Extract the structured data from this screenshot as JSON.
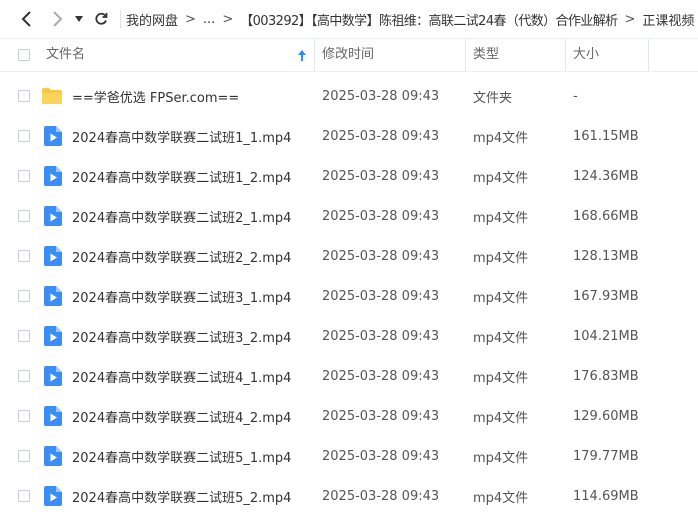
{
  "breadcrumb": {
    "items": [
      "我的网盘",
      "...",
      "【003292】【高中数学】陈祖维：高联二试24春（代数）合作业解析",
      "正课视频"
    ]
  },
  "table": {
    "columns": {
      "name": "文件名",
      "modified": "修改时间",
      "type": "类型",
      "size": "大小"
    },
    "rows": [
      {
        "name": "==学爸优选 FPSer.com==",
        "modified": "2025-03-28 09:43",
        "type": "文件夹",
        "size": "-",
        "icon": "folder-icon"
      },
      {
        "name": "2024春高中数学联赛二试班1_1.mp4",
        "modified": "2025-03-28 09:43",
        "type": "mp4文件",
        "size": "161.15MB",
        "icon": "video-file-icon"
      },
      {
        "name": "2024春高中数学联赛二试班1_2.mp4",
        "modified": "2025-03-28 09:43",
        "type": "mp4文件",
        "size": "124.36MB",
        "icon": "video-file-icon"
      },
      {
        "name": "2024春高中数学联赛二试班2_1.mp4",
        "modified": "2025-03-28 09:43",
        "type": "mp4文件",
        "size": "168.66MB",
        "icon": "video-file-icon"
      },
      {
        "name": "2024春高中数学联赛二试班2_2.mp4",
        "modified": "2025-03-28 09:43",
        "type": "mp4文件",
        "size": "128.13MB",
        "icon": "video-file-icon"
      },
      {
        "name": "2024春高中数学联赛二试班3_1.mp4",
        "modified": "2025-03-28 09:43",
        "type": "mp4文件",
        "size": "167.93MB",
        "icon": "video-file-icon"
      },
      {
        "name": "2024春高中数学联赛二试班3_2.mp4",
        "modified": "2025-03-28 09:43",
        "type": "mp4文件",
        "size": "104.21MB",
        "icon": "video-file-icon"
      },
      {
        "name": "2024春高中数学联赛二试班4_1.mp4",
        "modified": "2025-03-28 09:43",
        "type": "mp4文件",
        "size": "176.83MB",
        "icon": "video-file-icon"
      },
      {
        "name": "2024春高中数学联赛二试班4_2.mp4",
        "modified": "2025-03-28 09:43",
        "type": "mp4文件",
        "size": "129.60MB",
        "icon": "video-file-icon"
      },
      {
        "name": "2024春高中数学联赛二试班5_1.mp4",
        "modified": "2025-03-28 09:43",
        "type": "mp4文件",
        "size": "179.77MB",
        "icon": "video-file-icon"
      },
      {
        "name": "2024春高中数学联赛二试班5_2.mp4",
        "modified": "2025-03-28 09:43",
        "type": "mp4文件",
        "size": "114.69MB",
        "icon": "video-file-icon"
      }
    ]
  },
  "colors": {
    "accent": "#2f8cff",
    "folder": "#f7c948",
    "video": "#3b8ef6"
  }
}
